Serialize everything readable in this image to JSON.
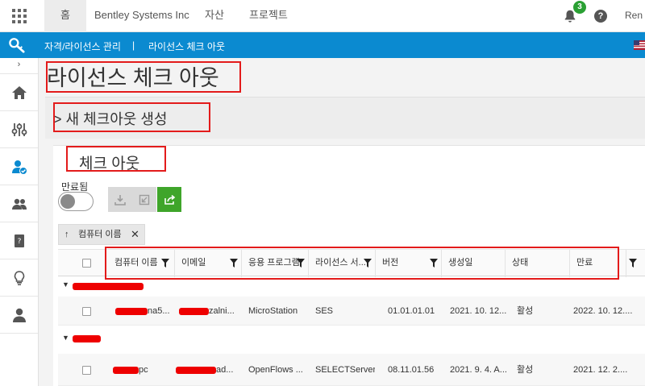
{
  "topbar": {
    "tabs": [
      {
        "label": "홈",
        "active": true
      },
      {
        "label": "Bentley Systems Inc",
        "active": false
      },
      {
        "label": "자산",
        "active": false
      },
      {
        "label": "프로젝트",
        "active": false
      }
    ],
    "notification_count": "3",
    "help_label": "?",
    "user_name": "Ren Z"
  },
  "breadcrumb": {
    "parent": "자격/라이선스 관리",
    "separator": "|",
    "current": "라이선스 체크 아웃"
  },
  "sidebar": {
    "collapse_label": "›",
    "items": [
      {
        "icon": "home-icon"
      },
      {
        "icon": "sliders-icon"
      },
      {
        "icon": "user-check-icon",
        "active": true
      },
      {
        "icon": "users-icon"
      },
      {
        "icon": "book-icon"
      },
      {
        "icon": "lightbulb-icon"
      },
      {
        "icon": "person-icon"
      }
    ]
  },
  "page": {
    "title": "라이선스 체크 아웃",
    "new_section_title": "> 새 체크아웃 생성",
    "list_title": "체크 아웃",
    "expired_label": "만료됨",
    "expired_toggle_on": false
  },
  "sort_chip": {
    "arrow": "↑",
    "label": "컴퓨터 이름",
    "close": "✕"
  },
  "table": {
    "columns": [
      "컴퓨터 이름",
      "이메일",
      "응용 프로그램",
      "라이선스 서...",
      "버전",
      "생성일",
      "상태",
      "만료"
    ],
    "groups": [
      {
        "rows": [
          {
            "computer": "na5...",
            "email": "zalni...",
            "application": "MicroStation",
            "license_server": "SES",
            "version": "01.01.01.01",
            "created": "2021. 10. 12....",
            "status": "활성",
            "expires": "2022. 10. 12...."
          }
        ]
      },
      {
        "rows": [
          {
            "computer": "pc",
            "email": "ad...",
            "application": "OpenFlows ...",
            "license_server": "SELECTServer",
            "version": "08.11.01.56",
            "created": "2021. 9. 4. A...",
            "status": "활성",
            "expires": "2021. 12. 2...."
          }
        ]
      }
    ]
  },
  "colors": {
    "accent_blue": "#0b8ad0",
    "badge_green": "#2aa033",
    "button_green": "#3fa52a",
    "highlight_red": "#e31b1b"
  }
}
